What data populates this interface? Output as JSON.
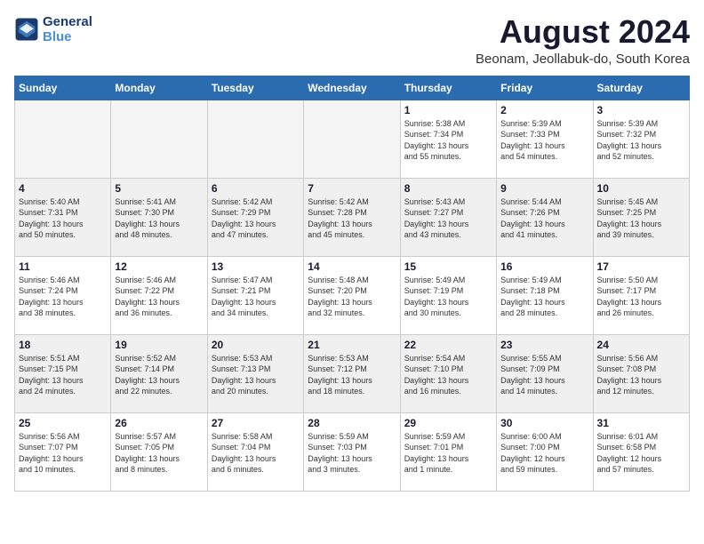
{
  "logo": {
    "line1": "General",
    "line2": "Blue"
  },
  "title": "August 2024",
  "location": "Beonam, Jeollabuk-do, South Korea",
  "days_of_week": [
    "Sunday",
    "Monday",
    "Tuesday",
    "Wednesday",
    "Thursday",
    "Friday",
    "Saturday"
  ],
  "weeks": [
    [
      {
        "day": "",
        "info": ""
      },
      {
        "day": "",
        "info": ""
      },
      {
        "day": "",
        "info": ""
      },
      {
        "day": "",
        "info": ""
      },
      {
        "day": "1",
        "info": "Sunrise: 5:38 AM\nSunset: 7:34 PM\nDaylight: 13 hours\nand 55 minutes."
      },
      {
        "day": "2",
        "info": "Sunrise: 5:39 AM\nSunset: 7:33 PM\nDaylight: 13 hours\nand 54 minutes."
      },
      {
        "day": "3",
        "info": "Sunrise: 5:39 AM\nSunset: 7:32 PM\nDaylight: 13 hours\nand 52 minutes."
      }
    ],
    [
      {
        "day": "4",
        "info": "Sunrise: 5:40 AM\nSunset: 7:31 PM\nDaylight: 13 hours\nand 50 minutes."
      },
      {
        "day": "5",
        "info": "Sunrise: 5:41 AM\nSunset: 7:30 PM\nDaylight: 13 hours\nand 48 minutes."
      },
      {
        "day": "6",
        "info": "Sunrise: 5:42 AM\nSunset: 7:29 PM\nDaylight: 13 hours\nand 47 minutes."
      },
      {
        "day": "7",
        "info": "Sunrise: 5:42 AM\nSunset: 7:28 PM\nDaylight: 13 hours\nand 45 minutes."
      },
      {
        "day": "8",
        "info": "Sunrise: 5:43 AM\nSunset: 7:27 PM\nDaylight: 13 hours\nand 43 minutes."
      },
      {
        "day": "9",
        "info": "Sunrise: 5:44 AM\nSunset: 7:26 PM\nDaylight: 13 hours\nand 41 minutes."
      },
      {
        "day": "10",
        "info": "Sunrise: 5:45 AM\nSunset: 7:25 PM\nDaylight: 13 hours\nand 39 minutes."
      }
    ],
    [
      {
        "day": "11",
        "info": "Sunrise: 5:46 AM\nSunset: 7:24 PM\nDaylight: 13 hours\nand 38 minutes."
      },
      {
        "day": "12",
        "info": "Sunrise: 5:46 AM\nSunset: 7:22 PM\nDaylight: 13 hours\nand 36 minutes."
      },
      {
        "day": "13",
        "info": "Sunrise: 5:47 AM\nSunset: 7:21 PM\nDaylight: 13 hours\nand 34 minutes."
      },
      {
        "day": "14",
        "info": "Sunrise: 5:48 AM\nSunset: 7:20 PM\nDaylight: 13 hours\nand 32 minutes."
      },
      {
        "day": "15",
        "info": "Sunrise: 5:49 AM\nSunset: 7:19 PM\nDaylight: 13 hours\nand 30 minutes."
      },
      {
        "day": "16",
        "info": "Sunrise: 5:49 AM\nSunset: 7:18 PM\nDaylight: 13 hours\nand 28 minutes."
      },
      {
        "day": "17",
        "info": "Sunrise: 5:50 AM\nSunset: 7:17 PM\nDaylight: 13 hours\nand 26 minutes."
      }
    ],
    [
      {
        "day": "18",
        "info": "Sunrise: 5:51 AM\nSunset: 7:15 PM\nDaylight: 13 hours\nand 24 minutes."
      },
      {
        "day": "19",
        "info": "Sunrise: 5:52 AM\nSunset: 7:14 PM\nDaylight: 13 hours\nand 22 minutes."
      },
      {
        "day": "20",
        "info": "Sunrise: 5:53 AM\nSunset: 7:13 PM\nDaylight: 13 hours\nand 20 minutes."
      },
      {
        "day": "21",
        "info": "Sunrise: 5:53 AM\nSunset: 7:12 PM\nDaylight: 13 hours\nand 18 minutes."
      },
      {
        "day": "22",
        "info": "Sunrise: 5:54 AM\nSunset: 7:10 PM\nDaylight: 13 hours\nand 16 minutes."
      },
      {
        "day": "23",
        "info": "Sunrise: 5:55 AM\nSunset: 7:09 PM\nDaylight: 13 hours\nand 14 minutes."
      },
      {
        "day": "24",
        "info": "Sunrise: 5:56 AM\nSunset: 7:08 PM\nDaylight: 13 hours\nand 12 minutes."
      }
    ],
    [
      {
        "day": "25",
        "info": "Sunrise: 5:56 AM\nSunset: 7:07 PM\nDaylight: 13 hours\nand 10 minutes."
      },
      {
        "day": "26",
        "info": "Sunrise: 5:57 AM\nSunset: 7:05 PM\nDaylight: 13 hours\nand 8 minutes."
      },
      {
        "day": "27",
        "info": "Sunrise: 5:58 AM\nSunset: 7:04 PM\nDaylight: 13 hours\nand 6 minutes."
      },
      {
        "day": "28",
        "info": "Sunrise: 5:59 AM\nSunset: 7:03 PM\nDaylight: 13 hours\nand 3 minutes."
      },
      {
        "day": "29",
        "info": "Sunrise: 5:59 AM\nSunset: 7:01 PM\nDaylight: 13 hours\nand 1 minute."
      },
      {
        "day": "30",
        "info": "Sunrise: 6:00 AM\nSunset: 7:00 PM\nDaylight: 12 hours\nand 59 minutes."
      },
      {
        "day": "31",
        "info": "Sunrise: 6:01 AM\nSunset: 6:58 PM\nDaylight: 12 hours\nand 57 minutes."
      }
    ]
  ]
}
